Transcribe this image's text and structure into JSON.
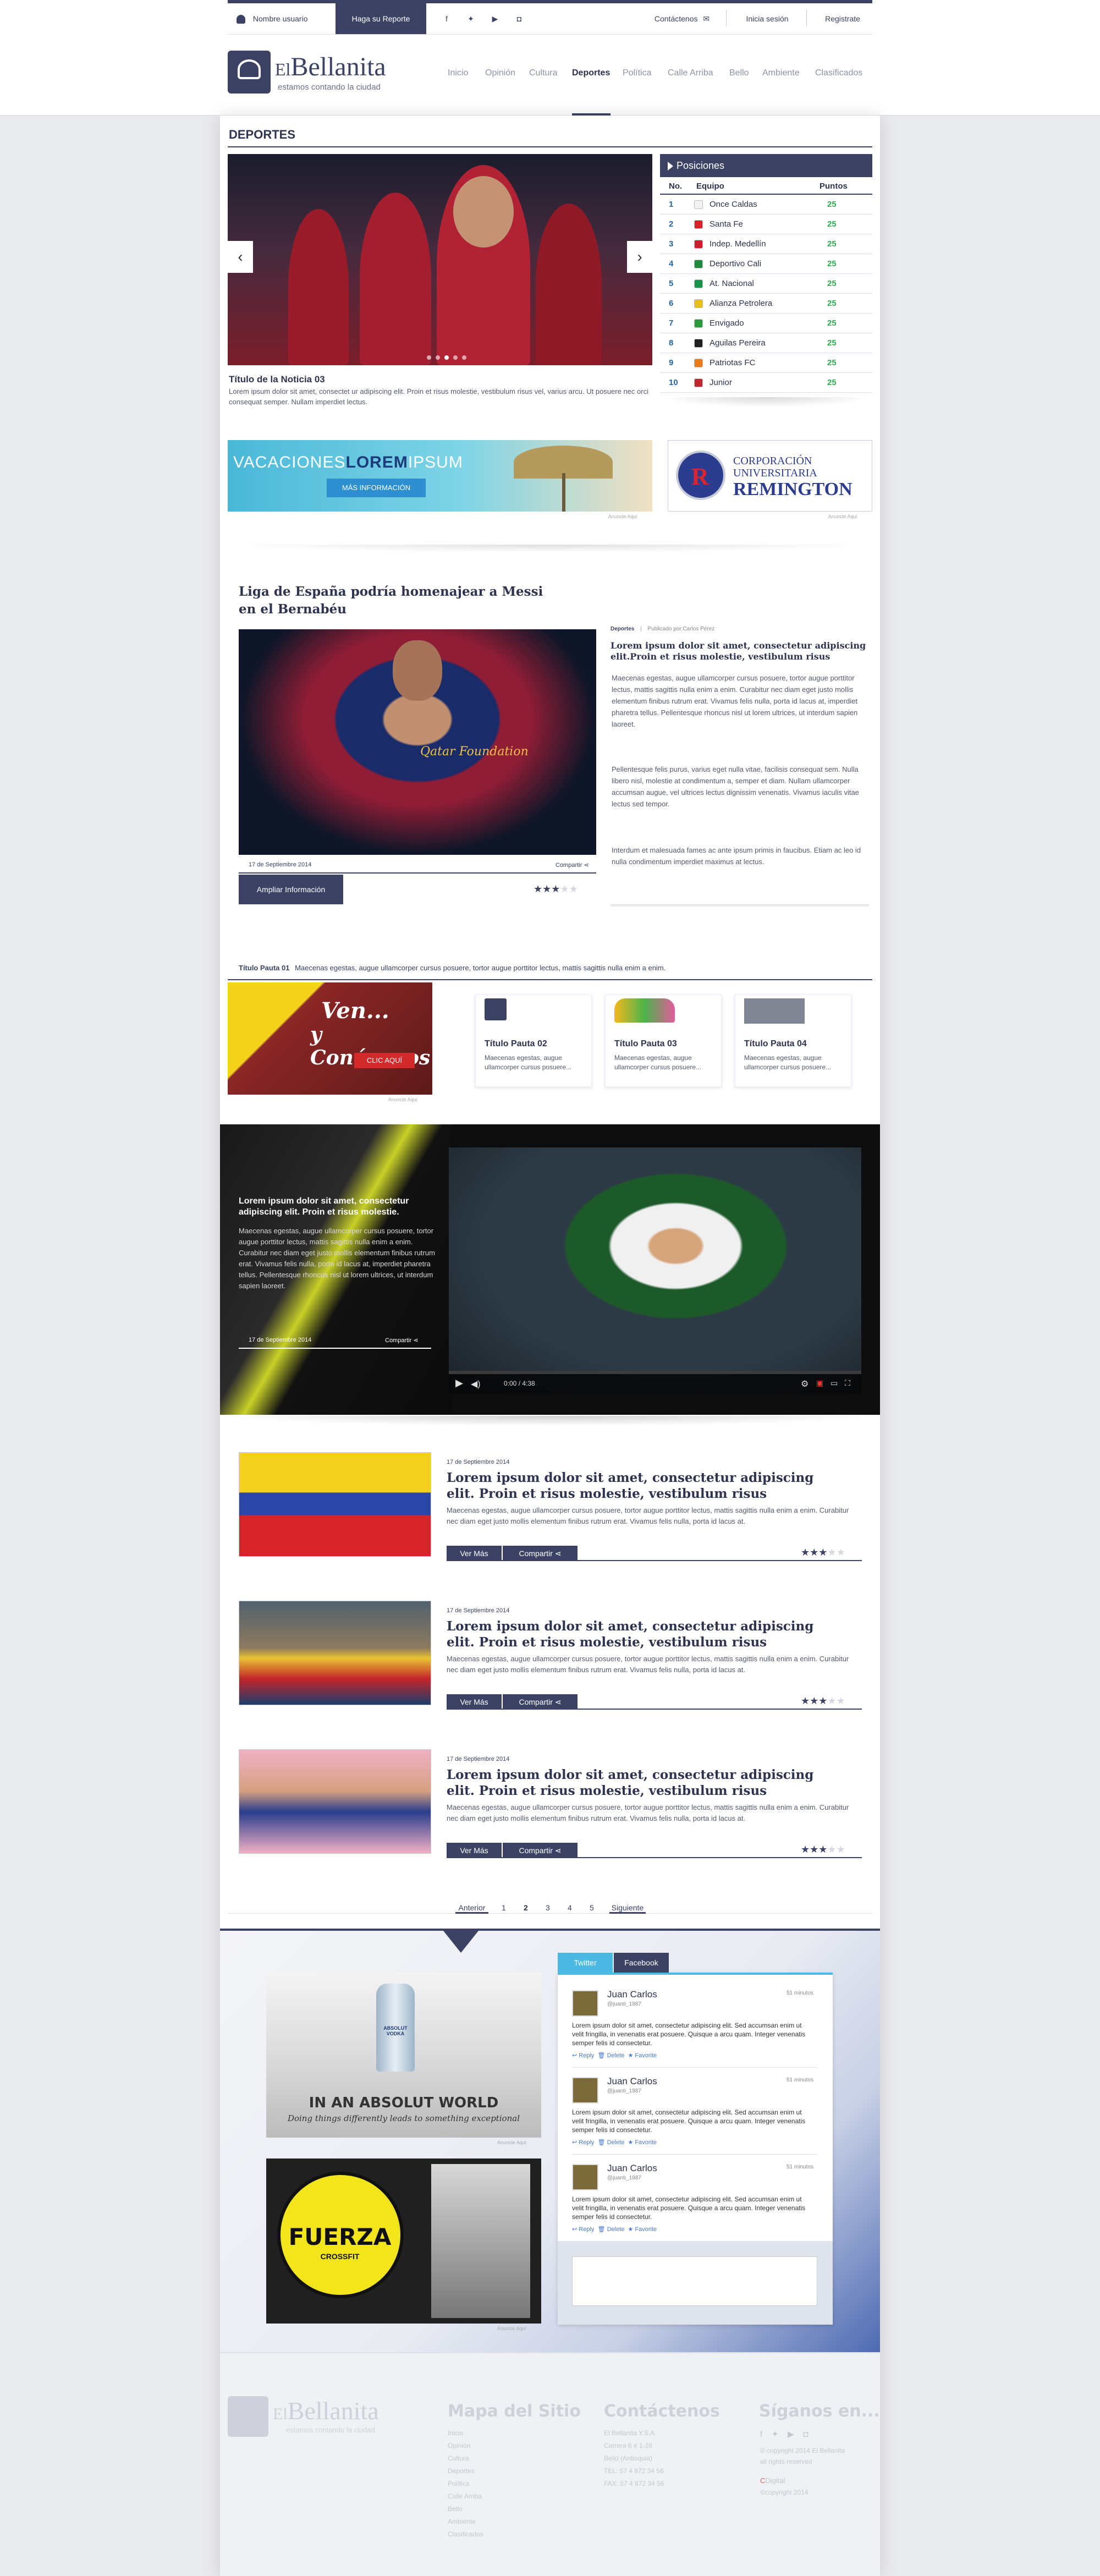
{
  "topbar": {
    "user": "Nombre usuario",
    "report": "Haga su Reporte",
    "contact": "Contáctenos",
    "login": "Inicia sesión",
    "register": "Registrate"
  },
  "brand": {
    "name_prefix": "El",
    "name": "Bellanita",
    "tagline": "estamos contando la ciudad"
  },
  "nav": [
    "Inicio",
    "Opinión",
    "Cultura",
    "Deportes",
    "Política",
    "Calle Arriba",
    "Bello",
    "Ambiente",
    "Clasificados"
  ],
  "section_title": "DEPORTES",
  "slider": {
    "title": "Título de la Noticia 03",
    "caption": "Lorem ipsum dolor sit amet, consectet ur adipiscing elit. Proin et risus molestie, vestibulum risus vel, varius arcu. Ut posuere nec orci consequat semper. Nullam imperdiet lectus."
  },
  "standings": {
    "title": "Posiciones",
    "headers": [
      "No.",
      "Equipo",
      "Puntos"
    ],
    "rows": [
      {
        "n": "1",
        "team": "Once Caldas",
        "pts": "25",
        "color": "#f2f2f2"
      },
      {
        "n": "2",
        "team": "Santa Fe",
        "pts": "25",
        "color": "#d8232a"
      },
      {
        "n": "3",
        "team": "Indep. Medellín",
        "pts": "25",
        "color": "#c81f2d"
      },
      {
        "n": "4",
        "team": "Deportivo Cali",
        "pts": "25",
        "color": "#1e8a3e"
      },
      {
        "n": "5",
        "team": "At. Nacional",
        "pts": "25",
        "color": "#18924a"
      },
      {
        "n": "6",
        "team": "Alianza Petrolera",
        "pts": "25",
        "color": "#e6c018"
      },
      {
        "n": "7",
        "team": "Envigado",
        "pts": "25",
        "color": "#2a9a3a"
      },
      {
        "n": "8",
        "team": "Aguilas Pereira",
        "pts": "25",
        "color": "#222222"
      },
      {
        "n": "9",
        "team": "Patriotas FC",
        "pts": "25",
        "color": "#e87a1a"
      },
      {
        "n": "10",
        "team": "Junior",
        "pts": "25",
        "color": "#c0262f"
      }
    ]
  },
  "ads": {
    "vac_left": "VACACIONES",
    "vac_mid": "LOREM",
    "vac_right": "IPSUM",
    "vac_btn": "MÁS INFORMACIÓN",
    "remi_top": "CORPORACIÓN",
    "remi_mid": "UNIVERSITARIA",
    "remi_big": "REMINGTON",
    "note": "Anuncie Aquí"
  },
  "article": {
    "title": "Liga de España podría homenajear a Messi en el Bernabéu",
    "date": "17 de Septiembre 2014",
    "share": "Compartir",
    "more": "Ampliar Información",
    "meta_cat": "Deportes",
    "meta_author": "Publicado por:Carlos Pérez",
    "lead": "Lorem ipsum dolor sit amet, consectetur adipiscing elit.Proin et risus molestie, vestibulum risus",
    "p1": "Maecenas egestas, augue ullamcorper cursus posuere, tortor augue porttitor lectus, mattis sagittis nulla enim a enim. Curabitur nec diam eget justo mollis elementum finibus rutrum erat. Vivamus felis nulla, porta id lacus at, imperdiet pharetra tellus. Pellentesque rhoncus nisl ut lorem ultrices, ut interdum sapien laoreet.",
    "p2": "Pellentesque felis purus, varius eget nulla vitae, facilisis consequat sem. Nulla libero nisl, molestie at condimentum a, semper et diam. Nullam ullamcorper accumsan augue, vel ultrices lectus dignissim venenatis. Vivamus iaculis vitae lectus sed tempor.",
    "p3": "Interdum et malesuada fames ac ante ipsum primis in faucibus. Etiam ac leo id nulla condimentum imperdiet maximus at lectus.",
    "shirt": "Qatar Foundation",
    "rating": 3
  },
  "pautas": {
    "p1_title": "Título Pauta 01",
    "p1_text": "Maecenas egestas, augue ullamcorper cursus posuere, tortor augue porttitor lectus, mattis sagittis nulla enim a enim.",
    "ad_line1": "Ven...",
    "ad_line2": "y Conócenos",
    "ad_btn": "CLIC AQUÍ",
    "cards": [
      {
        "title": "Título Pauta 02",
        "text": "Maecenas egestas, augue ullamcorper cursus posuere..."
      },
      {
        "title": "Título Pauta 03",
        "text": "Maecenas egestas, augue ullamcorper cursus posuere..."
      },
      {
        "title": "Título Pauta 04",
        "text": "Maecenas egestas, augue ullamcorper cursus posuere..."
      }
    ]
  },
  "video": {
    "title": "Lorem ipsum dolor sit amet, consectetur adipiscing elit. Proin et risus molestie.",
    "text": "Maecenas egestas, augue ullamcorper cursus posuere, tortor augue porttitor lectus, mattis sagittis nulla enim a enim. Curabitur nec diam eget justo mollis elementum finibus rutrum erat. Vivamus felis nulla, porta id lacus at, imperdiet pharetra tellus. Pellentesque rhoncus nisl ut lorem ultrices, ut interdum sapien laoreet.",
    "date": "17 de Septiembre 2014",
    "share": "Compartir",
    "time": "0:00 / 4:38"
  },
  "list": [
    {
      "date": "17 de Septiembre 2014",
      "title": "Lorem ipsum dolor sit amet, consectetur adipiscing elit. Proin et risus molestie, vestibulum risus",
      "text": "Maecenas egestas, augue ullamcorper cursus posuere, tortor augue porttitor lectus, mattis sagittis nulla enim a enim. Curabitur nec diam eget justo mollis elementum finibus rutrum erat. Vivamus felis nulla, porta id lacus at.",
      "more": "Ver Más",
      "share": "Compartir",
      "rating": 3
    },
    {
      "date": "17 de Septiembre 2014",
      "title": "Lorem ipsum dolor sit amet, consectetur adipiscing elit. Proin et risus molestie, vestibulum risus",
      "text": "Maecenas egestas, augue ullamcorper cursus posuere, tortor augue porttitor lectus, mattis sagittis nulla enim a enim. Curabitur nec diam eget justo mollis elementum finibus rutrum erat. Vivamus felis nulla, porta id lacus at.",
      "more": "Ver Más",
      "share": "Compartir",
      "rating": 3
    },
    {
      "date": "17 de Septiembre 2014",
      "title": "Lorem ipsum dolor sit amet, consectetur adipiscing elit. Proin et risus molestie, vestibulum risus",
      "text": "Maecenas egestas, augue ullamcorper cursus posuere, tortor augue porttitor lectus, mattis sagittis nulla enim a enim. Curabitur nec diam eget justo mollis elementum finibus rutrum erat. Vivamus felis nulla, porta id lacus at.",
      "more": "Ver Más",
      "share": "Compartir",
      "rating": 3
    }
  ],
  "pager": {
    "prev": "Anterior",
    "pages": [
      "1",
      "2",
      "3",
      "4",
      "5"
    ],
    "next": "Siguiente",
    "current": "2"
  },
  "social": {
    "tabs": [
      "Twitter",
      "Facebook"
    ],
    "absolut_brand": "ABSOLUT VODKA",
    "absolut_line1": "IN AN ABSOLUT WORLD",
    "absolut_line2": "Doing things differently leads to something exceptional",
    "fuerza": "FUERZA",
    "fuerza_sub": "CROSSFIT",
    "ad_note": "Anuncie Aquí",
    "tweets": [
      {
        "name": "Juan Carlos",
        "handle": "@juanti_1987",
        "time": "51 minutos",
        "text": "Lorem ipsum dolor sit amet, consectetur adipiscing elit. Sed accumsan enim ut velit fringilla, in venenatis erat posuere. Quisque a arcu quam. Integer venenatis semper felis id consectetur.",
        "actions": [
          "Reply",
          "Delete",
          "Favorite"
        ]
      },
      {
        "name": "Juan Carlos",
        "handle": "@juanti_1987",
        "time": "51 minutos",
        "text": "Lorem ipsum dolor sit amet, consectetur adipiscing elit. Sed accumsan enim ut velit fringilla, in venenatis erat posuere. Quisque a arcu quam. Integer venenatis semper felis id consectetur.",
        "actions": [
          "Reply",
          "Delete",
          "Favorite"
        ]
      },
      {
        "name": "Juan Carlos",
        "handle": "@juanti_1987",
        "time": "51 minutos",
        "text": "Lorem ipsum dolor sit amet, consectetur adipiscing elit. Sed accumsan enim ut velit fringilla, in venenatis erat posuere. Quisque a arcu quam. Integer venenatis semper felis id consectetur.",
        "actions": [
          "Reply",
          "Delete",
          "Favorite"
        ]
      }
    ]
  },
  "footer": {
    "sitemap_title": "Mapa del Sitio",
    "sitemap": [
      "Inicio",
      "Opinión",
      "Cultura",
      "Deportes",
      "Política",
      "Calle Arriba",
      "Bello",
      "Ambiente",
      "Clasificados"
    ],
    "contact_title": "Contáctenos",
    "contact": [
      "El Bellanita Y.S.A.",
      "Carrera 6 # 1-26",
      "Bello (Antioquia)",
      "TEL: 57 4 872 34 56",
      "FAX: 57 4 872 34 56"
    ],
    "follow_title": "Síganos en...",
    "copyright1": "© copyright 2014 El Bellanita",
    "copyright2": "all rights reserved",
    "agency": "Digital",
    "agency_copy": "©copyright 2014"
  },
  "colors": {
    "primary": "#3b4264",
    "accent_green": "#2cae4c",
    "twitter": "#4bb9e2"
  }
}
